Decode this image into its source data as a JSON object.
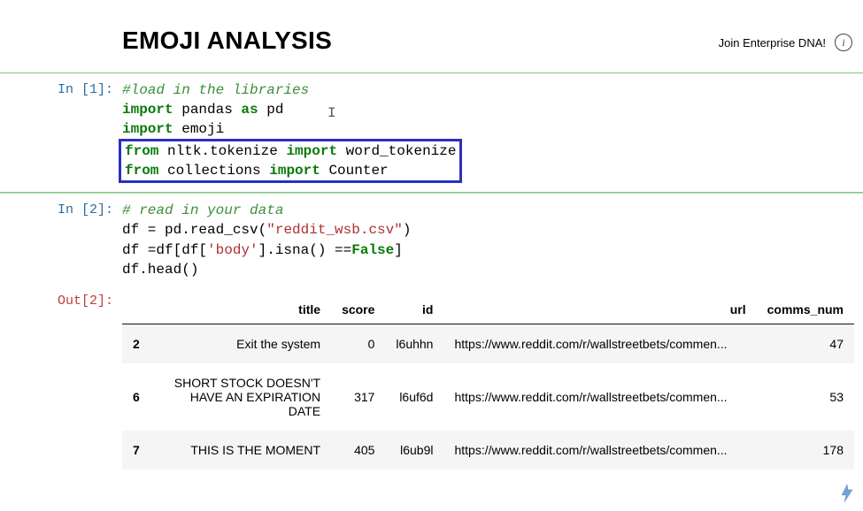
{
  "topbar": {
    "link_text": "Join Enterprise DNA!",
    "info_icon": "i"
  },
  "page": {
    "title": "EMOJI ANALYSIS"
  },
  "cells": {
    "cell1": {
      "prompt": "In [1]:",
      "line1_comment": "#load in the libraries",
      "line2_kw1": "import",
      "line2_rest": " pandas ",
      "line2_kw2": "as",
      "line2_rest2": " pd",
      "line3_kw1": "import",
      "line3_rest": " emoji",
      "line4_kw1": "from",
      "line4_mid": " nltk.tokenize ",
      "line4_kw2": "import",
      "line4_rest": " word_tokenize",
      "line5_kw1": "from",
      "line5_mid": " collections ",
      "line5_kw2": "import",
      "line5_rest": " Counter"
    },
    "cell2": {
      "prompt": "In [2]:",
      "line1_comment": "# read in your data",
      "line2a": "df = pd.read_csv(",
      "line2_str": "\"reddit_wsb.csv\"",
      "line2b": ")",
      "line3a": "df =df[df[",
      "line3_str": "'body'",
      "line3b": "].isna() ==",
      "line3_bool": "False",
      "line3c": "]",
      "line4": "df.head()"
    },
    "out2": {
      "prompt": "Out[2]:",
      "columns": [
        "",
        "title",
        "score",
        "id",
        "url",
        "comms_num"
      ],
      "rows": [
        {
          "idx": "2",
          "title": "Exit the system",
          "score": "0",
          "id": "l6uhhn",
          "url": "https://www.reddit.com/r/wallstreetbets/commen...",
          "comms_num": "47"
        },
        {
          "idx": "6",
          "title": "SHORT STOCK DOESN'T HAVE AN EXPIRATION DATE",
          "score": "317",
          "id": "l6uf6d",
          "url": "https://www.reddit.com/r/wallstreetbets/commen...",
          "comms_num": "53"
        },
        {
          "idx": "7",
          "title": "THIS IS THE MOMENT",
          "score": "405",
          "id": "l6ub9l",
          "url": "https://www.reddit.com/r/wallstreetbets/commen...",
          "comms_num": "178"
        }
      ]
    }
  }
}
